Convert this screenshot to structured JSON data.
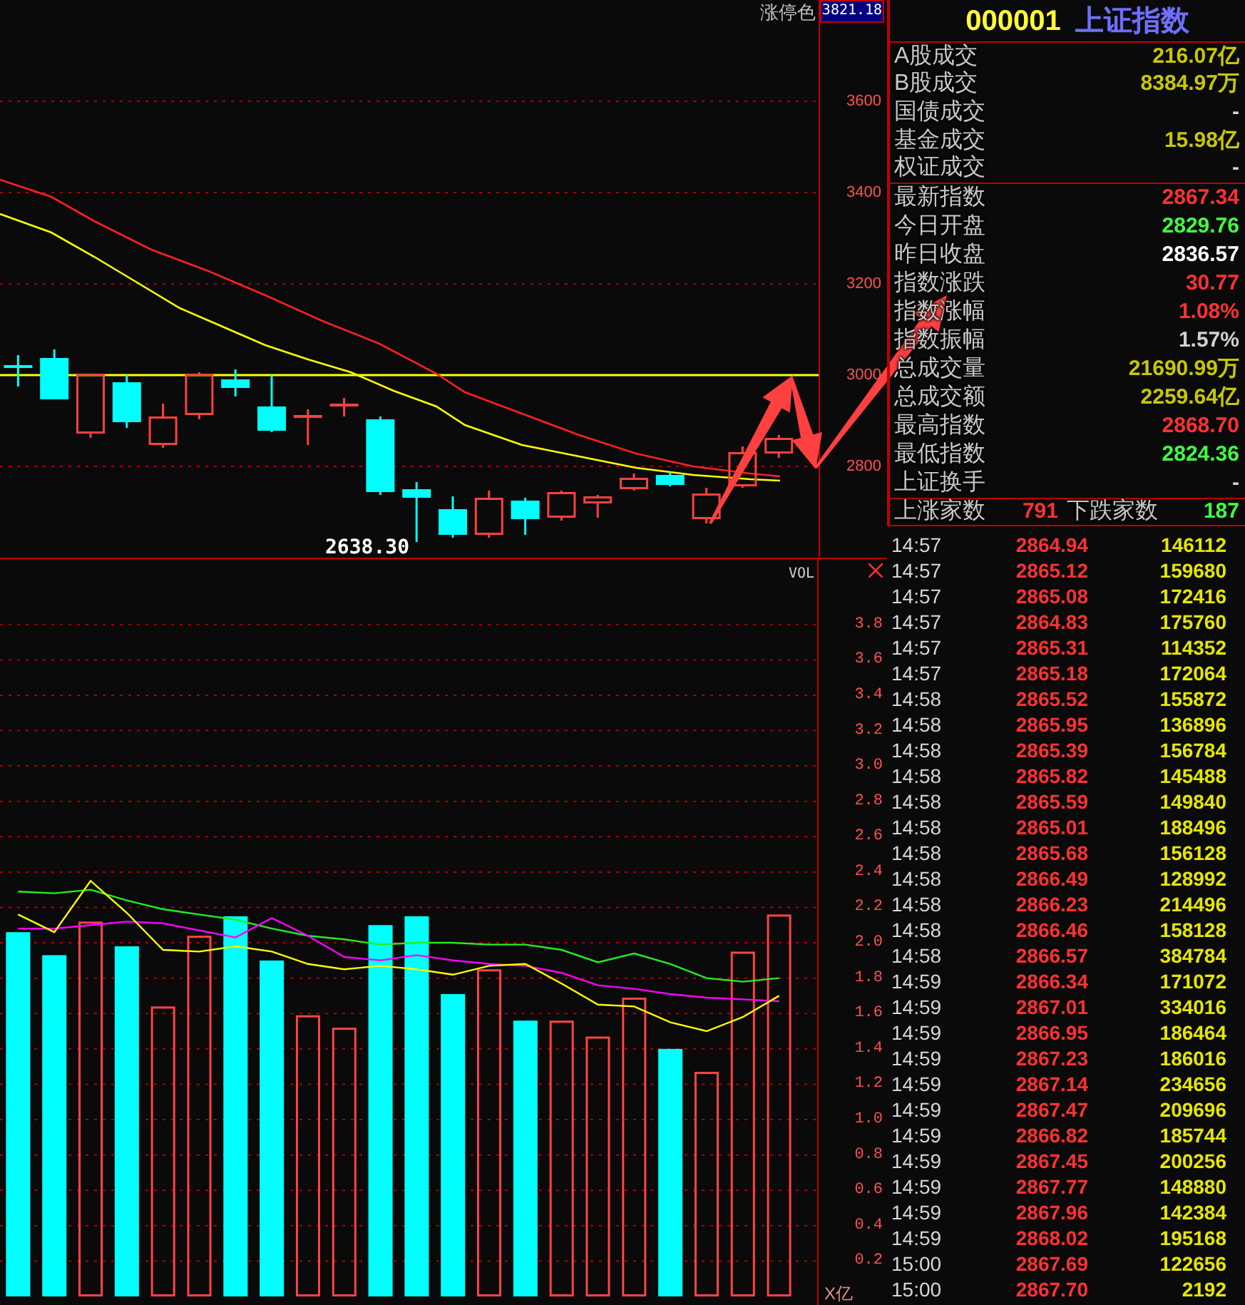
{
  "price_chart": {
    "corner_label": "涨停色",
    "axis_readout": "3821.18",
    "axis_labels": [
      "3600",
      "3400",
      "3200",
      "3000",
      "2800"
    ],
    "low_label": "2638.30"
  },
  "volume_chart": {
    "chart_data": {
      "type": "bar",
      "title": "VOL",
      "ylabel": "X亿",
      "ylim": [
        0,
        4.17
      ],
      "yticks": [
        0.2,
        0.4,
        0.6,
        0.8,
        {
          "value": 1,
          "label": "1.0"
        },
        1.2,
        1.4,
        1.6,
        1.8,
        {
          "value": 2,
          "label": "2.0"
        },
        2.2,
        2.4,
        2.6,
        2.8,
        {
          "value": 3,
          "label": "3.0"
        },
        3.2,
        3.4,
        3.6,
        3.8
      ],
      "grid": true,
      "stacked": true,
      "series": [
        {
          "type": "bar",
          "color": "#00ffff",
          "values": [
            2.06,
            1.93,
            null,
            1.98,
            null,
            null,
            2.15,
            1.9,
            null,
            null,
            2.1,
            2.15,
            1.71,
            null,
            1.56,
            null,
            null,
            null,
            1.4,
            null,
            null,
            null
          ]
        },
        {
          "type": "bar",
          "color": "#ff4444",
          "values": [
            null,
            null,
            2.12,
            null,
            1.64,
            2.04,
            null,
            null,
            1.59,
            1.52,
            null,
            null,
            null,
            1.85,
            null,
            1.56,
            1.47,
            1.69,
            null,
            1.27,
            1.95,
            2.16
          ]
        },
        {
          "type": "line",
          "color": "#22ee22",
          "values": [
            2.29,
            2.28,
            2.3,
            2.24,
            2.19,
            2.16,
            2.13,
            2.08,
            2.04,
            2.02,
            1.99,
            2.0,
            2.0,
            1.99,
            1.99,
            1.96,
            1.89,
            1.94,
            1.88,
            1.8,
            1.78,
            1.8
          ]
        },
        {
          "type": "line",
          "color": "#ff00ff",
          "values": [
            2.08,
            2.08,
            2.1,
            2.12,
            2.11,
            2.07,
            2.03,
            2.14,
            2.04,
            1.92,
            1.9,
            1.93,
            1.9,
            1.88,
            1.87,
            1.83,
            1.76,
            1.74,
            1.71,
            1.69,
            1.68,
            1.67
          ]
        },
        {
          "type": "line",
          "color": "#ffff00",
          "values": [
            2.16,
            2.06,
            2.35,
            2.17,
            1.96,
            1.95,
            1.98,
            1.95,
            1.88,
            1.85,
            1.87,
            1.85,
            1.82,
            1.87,
            1.88,
            1.77,
            1.65,
            1.64,
            1.55,
            1.5,
            1.58,
            1.7
          ]
        }
      ]
    }
  },
  "quote_panel": {
    "code": "000001",
    "name": "上证指数",
    "turnover_rows": [
      {
        "label": "A股成交",
        "value": "216.07亿",
        "color": "#c8c800"
      },
      {
        "label": "B股成交",
        "value": "8384.97万",
        "color": "#c8c800"
      },
      {
        "label": "国债成交",
        "value": "-",
        "color": "#d0d0d0"
      },
      {
        "label": "基金成交",
        "value": "15.98亿",
        "color": "#c8c800"
      },
      {
        "label": "权证成交",
        "value": "-",
        "color": "#d0d0d0"
      }
    ],
    "index_rows": [
      {
        "label": "最新指数",
        "value": "2867.34",
        "color": "#ff3232"
      },
      {
        "label": "今日开盘",
        "value": "2829.76",
        "color": "#40ff40"
      },
      {
        "label": "昨日收盘",
        "value": "2836.57",
        "color": "#ffffff"
      },
      {
        "label": "指数涨跌",
        "value": "30.77",
        "color": "#ff3232"
      },
      {
        "label": "指数涨幅",
        "value": "1.08%",
        "color": "#ff3232"
      },
      {
        "label": "指数振幅",
        "value": "1.57%",
        "color": "#d0d0d0"
      },
      {
        "label": "总成交量",
        "value": "21690.99万",
        "color": "#c8c800"
      },
      {
        "label": "总成交额",
        "value": "2259.64亿",
        "color": "#c8c800"
      },
      {
        "label": "最高指数",
        "value": "2868.70",
        "color": "#ff3232"
      },
      {
        "label": "最低指数",
        "value": "2824.36",
        "color": "#40ff40"
      },
      {
        "label": "上证换手",
        "value": "-",
        "color": "#d0d0d0"
      }
    ],
    "breadth": {
      "up_label": "上涨家数",
      "up_count": "791",
      "down_label": "下跌家数",
      "down_count": "187"
    }
  },
  "trades": [
    {
      "time": "14:57",
      "price": "2864.94",
      "volume": "146112"
    },
    {
      "time": "14:57",
      "price": "2865.12",
      "volume": "159680"
    },
    {
      "time": "14:57",
      "price": "2865.08",
      "volume": "172416"
    },
    {
      "time": "14:57",
      "price": "2864.83",
      "volume": "175760"
    },
    {
      "time": "14:57",
      "price": "2865.31",
      "volume": "114352"
    },
    {
      "time": "14:57",
      "price": "2865.18",
      "volume": "172064"
    },
    {
      "time": "14:58",
      "price": "2865.52",
      "volume": "155872"
    },
    {
      "time": "14:58",
      "price": "2865.95",
      "volume": "136896"
    },
    {
      "time": "14:58",
      "price": "2865.39",
      "volume": "156784"
    },
    {
      "time": "14:58",
      "price": "2865.82",
      "volume": "145488"
    },
    {
      "time": "14:58",
      "price": "2865.59",
      "volume": "149840"
    },
    {
      "time": "14:58",
      "price": "2865.01",
      "volume": "188496"
    },
    {
      "time": "14:58",
      "price": "2865.68",
      "volume": "156128"
    },
    {
      "time": "14:58",
      "price": "2866.49",
      "volume": "128992"
    },
    {
      "time": "14:58",
      "price": "2866.23",
      "volume": "214496"
    },
    {
      "time": "14:58",
      "price": "2866.46",
      "volume": "158128"
    },
    {
      "time": "14:58",
      "price": "2866.57",
      "volume": "384784"
    },
    {
      "time": "14:59",
      "price": "2866.34",
      "volume": "171072"
    },
    {
      "time": "14:59",
      "price": "2867.01",
      "volume": "334016"
    },
    {
      "time": "14:59",
      "price": "2866.95",
      "volume": "186464"
    },
    {
      "time": "14:59",
      "price": "2867.23",
      "volume": "186016"
    },
    {
      "time": "14:59",
      "price": "2867.14",
      "volume": "234656"
    },
    {
      "time": "14:59",
      "price": "2867.47",
      "volume": "209696"
    },
    {
      "time": "14:59",
      "price": "2866.82",
      "volume": "185744"
    },
    {
      "time": "14:59",
      "price": "2867.45",
      "volume": "200256"
    },
    {
      "time": "14:59",
      "price": "2867.77",
      "volume": "148880"
    },
    {
      "time": "14:59",
      "price": "2867.96",
      "volume": "142384"
    },
    {
      "time": "14:59",
      "price": "2868.02",
      "volume": "195168"
    },
    {
      "time": "15:00",
      "price": "2867.69",
      "volume": "122656"
    },
    {
      "time": "15:00",
      "price": "2867.70",
      "volume": "2192"
    }
  ]
}
